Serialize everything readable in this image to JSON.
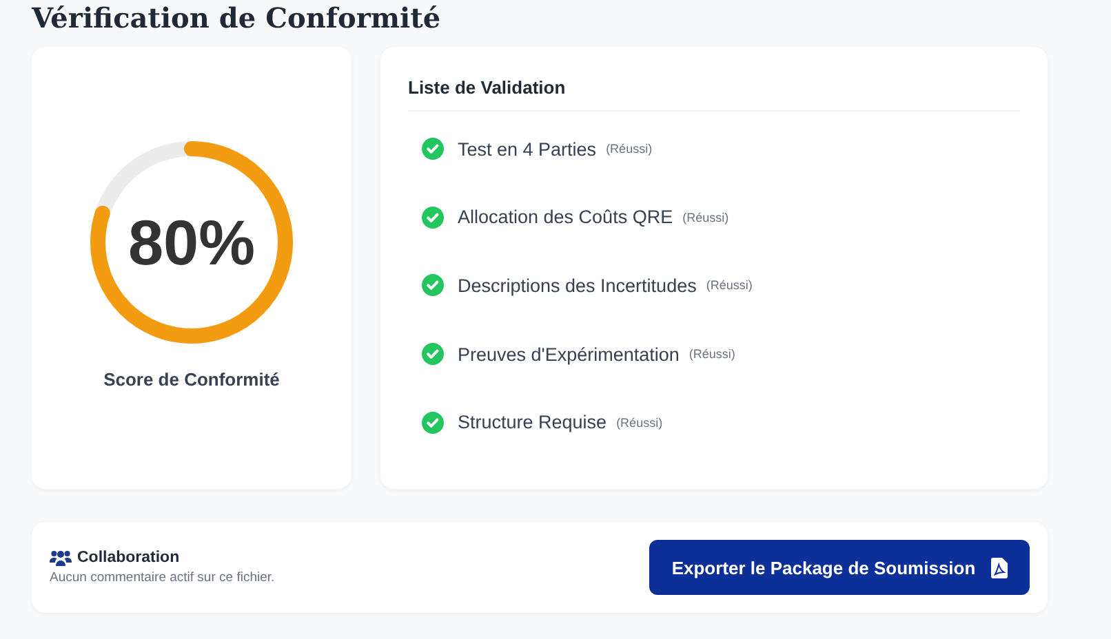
{
  "title": "Vérification de Conformité",
  "score": {
    "value": "80%",
    "level": 0.8,
    "label": "Score de Conformité"
  },
  "checklist": {
    "title": "Liste de Validation",
    "items": [
      {
        "label": "Test en 4 Parties",
        "status": "(Réussi)",
        "passed": true
      },
      {
        "label": "Allocation des Coûts QRE",
        "status": "(Réussi)",
        "passed": true
      },
      {
        "label": "Descriptions des Incertitudes",
        "status": "(Réussi)",
        "passed": true
      },
      {
        "label": "Preuves d'Expérimentation",
        "status": "(Réussi)",
        "passed": true
      },
      {
        "label": "Structure Requise",
        "status": "(Réussi)",
        "passed": true
      }
    ]
  },
  "collaboration": {
    "title": "Collaboration",
    "message": "Aucun commentaire actif sur ce fichier."
  },
  "export_button": "Exporter le Package de Soumission"
}
